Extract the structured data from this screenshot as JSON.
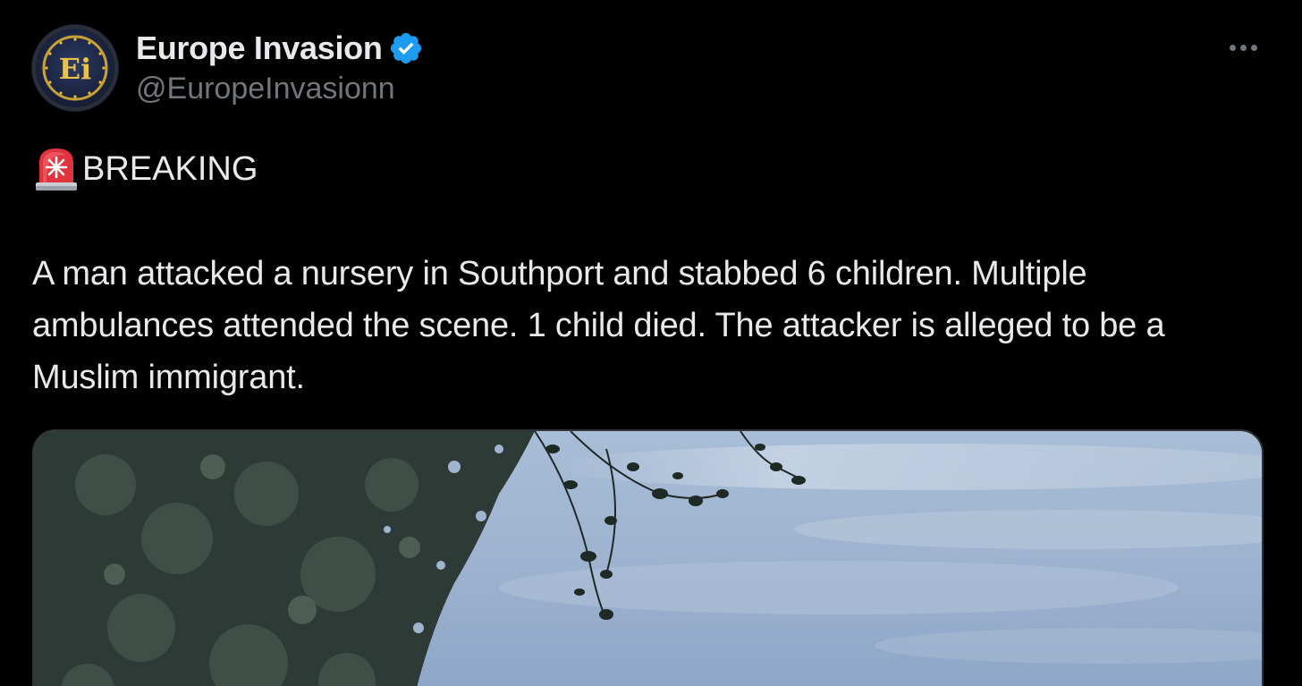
{
  "tweet": {
    "author": {
      "display_name": "Europe Invasion",
      "handle": "@EuropeInvasionn",
      "avatar_initials": "Ei",
      "verified": true,
      "verified_color": "#1d9bf0"
    },
    "more_icon": "more-horizontal-icon",
    "headline": {
      "icon": "police-siren-emoji",
      "text": "BREAKING"
    },
    "body": "A man attacked a nursery in Southport and stabbed 6 children. Multiple ambulances attended the scene. 1 child died. The attacker is alleged to be a Muslim immigrant.",
    "media": {
      "type": "photo",
      "subject": "tree-branches-against-sky"
    }
  },
  "colors": {
    "background": "#000000",
    "text_primary": "#e7e9ea",
    "text_secondary": "#71767b",
    "border": "#2f3336",
    "accent": "#1d9bf0"
  }
}
